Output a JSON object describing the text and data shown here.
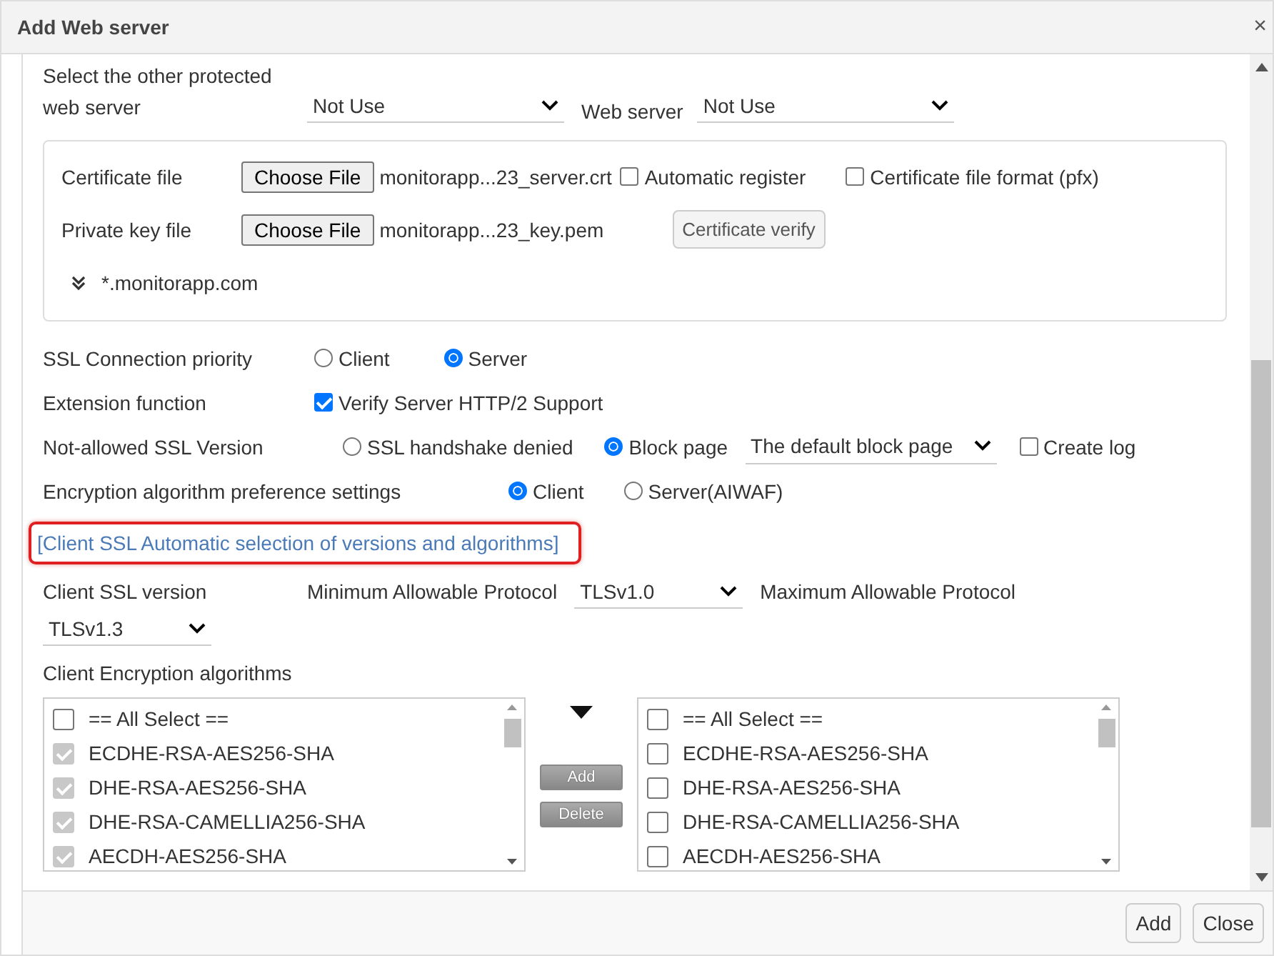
{
  "window": {
    "title": "Add Web server",
    "close": "×"
  },
  "protected_server": {
    "label": "Select the other protected web server",
    "select": "Not Use",
    "web_server_label": "Web server",
    "web_server_select": "Not Use"
  },
  "certificate": {
    "cert_label": "Certificate file",
    "cert_button": "Choose File",
    "cert_file": "monitorapp...23_server.crt",
    "auto_register": {
      "label": "Automatic register",
      "checked": false
    },
    "pfx": {
      "label": "Certificate file format (pfx)",
      "checked": false
    },
    "key_label": "Private key file",
    "key_button": "Choose File",
    "key_file": "monitorapp...23_key.pem",
    "verify_button": "Certificate verify",
    "domain": "*.monitorapp.com"
  },
  "ssl_priority": {
    "label": "SSL Connection priority",
    "options": [
      {
        "label": "Client",
        "selected": false
      },
      {
        "label": "Server",
        "selected": true
      }
    ]
  },
  "extension": {
    "label": "Extension function",
    "option": {
      "label": "Verify Server HTTP/2 Support",
      "checked": true
    }
  },
  "not_allowed": {
    "label": "Not-allowed SSL Version",
    "options": [
      {
        "label": "SSL handshake denied",
        "selected": false
      },
      {
        "label": "Block page",
        "selected": true
      }
    ],
    "block_page_select": "The default block page",
    "create_log": {
      "label": "Create log",
      "checked": false
    }
  },
  "encryption_pref": {
    "label": "Encryption algorithm preference settings",
    "options": [
      {
        "label": "Client",
        "selected": true
      },
      {
        "label": "Server(AIWAF)",
        "selected": false
      }
    ]
  },
  "auto_link": "[Client SSL Automatic selection of versions and algorithms]",
  "client_ssl": {
    "label": "Client SSL version",
    "min_label": "Minimum Allowable Protocol",
    "min_select": "TLSv1.0",
    "max_label": "Maximum Allowable Protocol",
    "max_select": "TLSv1.3"
  },
  "algorithms": {
    "label": "Client Encryption algorithms",
    "add": "Add",
    "delete": "Delete",
    "left": [
      {
        "label": "== All Select ==",
        "checked": false,
        "disabled": false
      },
      {
        "label": "ECDHE-RSA-AES256-SHA",
        "checked": true,
        "disabled": true
      },
      {
        "label": "DHE-RSA-AES256-SHA",
        "checked": true,
        "disabled": true
      },
      {
        "label": "DHE-RSA-CAMELLIA256-SHA",
        "checked": true,
        "disabled": true
      },
      {
        "label": "AECDH-AES256-SHA",
        "checked": true,
        "disabled": true
      }
    ],
    "right": [
      {
        "label": "== All Select ==",
        "checked": false,
        "disabled": false
      },
      {
        "label": "ECDHE-RSA-AES256-SHA",
        "checked": false,
        "disabled": false
      },
      {
        "label": "DHE-RSA-AES256-SHA",
        "checked": false,
        "disabled": false
      },
      {
        "label": "DHE-RSA-CAMELLIA256-SHA",
        "checked": false,
        "disabled": false
      },
      {
        "label": "AECDH-AES256-SHA",
        "checked": false,
        "disabled": false
      }
    ]
  },
  "footer": {
    "buttons": [
      "Add",
      "Close"
    ]
  }
}
